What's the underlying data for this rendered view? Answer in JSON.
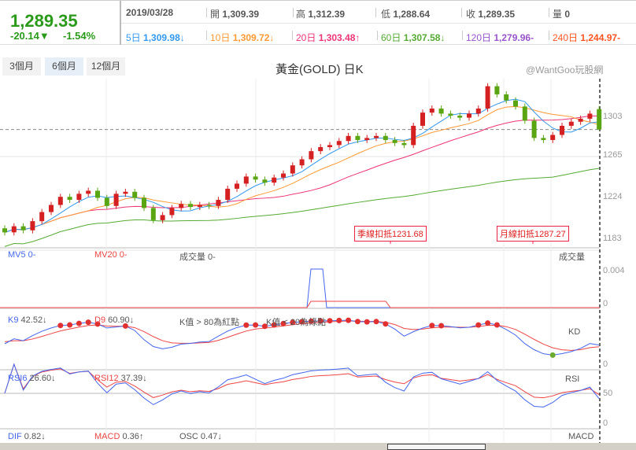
{
  "quote": {
    "price": "1,289.35",
    "change": "-20.14▼",
    "change_pct": "-1.54%",
    "date": "2019/03/28",
    "open_label": "開",
    "open": "1,309.39",
    "high_label": "高",
    "high": "1,312.39",
    "low_label": "低",
    "low": "1,288.64",
    "close_label": "收",
    "close": "1,289.35",
    "volume_label": "量",
    "volume": "0"
  },
  "moving_averages": [
    {
      "label": "5日",
      "value": "1,309.98↓",
      "color": "#3399ee"
    },
    {
      "label": "10日",
      "value": "1,309.72↓",
      "color": "#ff9933"
    },
    {
      "label": "20日",
      "value": "1,303.48↑",
      "color": "#ee3377"
    },
    {
      "label": "60日",
      "value": "1,307.58↓",
      "color": "#55aa33"
    },
    {
      "label": "120日",
      "value": "1,279.96-",
      "color": "#9955cc"
    },
    {
      "label": "240日",
      "value": "1,244.97-",
      "color": "#ff5522"
    }
  ],
  "tabs": [
    {
      "label": "3個月",
      "active": false
    },
    {
      "label": "6個月",
      "active": true
    },
    {
      "label": "12個月",
      "active": false
    }
  ],
  "title": "黃金(GOLD) 日K",
  "watermark": "@WantGoo玩股網",
  "colors": {
    "up": "#d42020",
    "down": "#5aa512",
    "k": "#4466ee",
    "d": "#ee4444"
  },
  "chart_data": {
    "type": "candlestick",
    "price_axis_ticks": [
      1303,
      1265,
      1224,
      1183
    ],
    "last_price": 1289.35,
    "open": [
      1192,
      1188,
      1194,
      1190,
      1199,
      1208,
      1215,
      1223,
      1220,
      1226,
      1229,
      1222,
      1214,
      1226,
      1228,
      1222,
      1212,
      1200,
      1205,
      1212,
      1216,
      1213,
      1215,
      1214,
      1220,
      1231,
      1236,
      1243,
      1240,
      1237,
      1242,
      1246,
      1254,
      1260,
      1268,
      1272,
      1274,
      1278,
      1283,
      1279,
      1281,
      1283,
      1279,
      1276,
      1274,
      1293,
      1306,
      1310,
      1305,
      1303,
      1301,
      1305,
      1310,
      1332,
      1324,
      1318,
      1312,
      1298,
      1281,
      1279,
      1284,
      1293,
      1297,
      1300,
      1309.39
    ],
    "high": [
      1195,
      1197,
      1197,
      1202,
      1211,
      1218,
      1226,
      1226,
      1229,
      1232,
      1232,
      1225,
      1229,
      1231,
      1231,
      1225,
      1215,
      1208,
      1215,
      1219,
      1219,
      1218,
      1218,
      1223,
      1234,
      1239,
      1246,
      1246,
      1243,
      1245,
      1249,
      1257,
      1263,
      1271,
      1275,
      1277,
      1281,
      1286,
      1286,
      1284,
      1286,
      1286,
      1282,
      1279,
      1296,
      1309,
      1313,
      1313,
      1308,
      1306,
      1308,
      1313,
      1335,
      1335,
      1327,
      1321,
      1315,
      1301,
      1284,
      1287,
      1296,
      1300,
      1303,
      1308,
      1312.39
    ],
    "low": [
      1185,
      1185,
      1187,
      1187,
      1196,
      1205,
      1212,
      1217,
      1217,
      1223,
      1219,
      1211,
      1211,
      1223,
      1219,
      1209,
      1197,
      1197,
      1202,
      1209,
      1210,
      1210,
      1211,
      1211,
      1217,
      1228,
      1233,
      1237,
      1234,
      1234,
      1239,
      1243,
      1251,
      1257,
      1265,
      1269,
      1271,
      1275,
      1276,
      1276,
      1278,
      1276,
      1273,
      1271,
      1271,
      1290,
      1303,
      1302,
      1300,
      1298,
      1298,
      1302,
      1307,
      1321,
      1315,
      1309,
      1295,
      1278,
      1276,
      1276,
      1281,
      1290,
      1294,
      1297,
      1288.64
    ],
    "close": [
      1188,
      1194,
      1190,
      1199,
      1208,
      1215,
      1223,
      1220,
      1226,
      1229,
      1222,
      1214,
      1226,
      1228,
      1222,
      1212,
      1200,
      1205,
      1212,
      1216,
      1213,
      1215,
      1214,
      1220,
      1231,
      1236,
      1243,
      1240,
      1237,
      1242,
      1246,
      1254,
      1260,
      1268,
      1272,
      1274,
      1278,
      1283,
      1279,
      1281,
      1283,
      1279,
      1276,
      1274,
      1293,
      1306,
      1310,
      1305,
      1303,
      1301,
      1305,
      1310,
      1332,
      1324,
      1318,
      1312,
      1298,
      1281,
      1279,
      1284,
      1293,
      1297,
      1300,
      1305,
      1289.35
    ],
    "annotations": [
      {
        "label": "季線扣抵1231.68"
      },
      {
        "label": "月線扣抵1287.27"
      }
    ],
    "volume_panel": {
      "labels": [
        "MV5 0-",
        "MV20 0-",
        "成交量 0-"
      ],
      "name": "成交量",
      "ticks": [
        "0.004",
        "0"
      ]
    },
    "kd_panel": {
      "k_label": "K9",
      "k": "42.52↓",
      "d_label": "D9",
      "d": "60.90↓",
      "note_hi": "K值 > 80為紅點",
      "note_lo": "K值 < 20為綠點",
      "name": "KD",
      "ticks": [
        "0"
      ]
    },
    "rsi_panel": {
      "rsi6_label": "RSI6",
      "rsi6": "26.60↓",
      "rsi12_label": "RSI12",
      "rsi12": "37.39↓",
      "name": "RSI",
      "ticks": [
        "50",
        "0"
      ]
    },
    "macd_panel": {
      "dif_label": "DIF",
      "dif": "0.82↓",
      "macd_label": "MACD",
      "macd": "0.36↑",
      "osc_label": "OSC",
      "osc": "0.47↓",
      "name": "MACD"
    }
  }
}
